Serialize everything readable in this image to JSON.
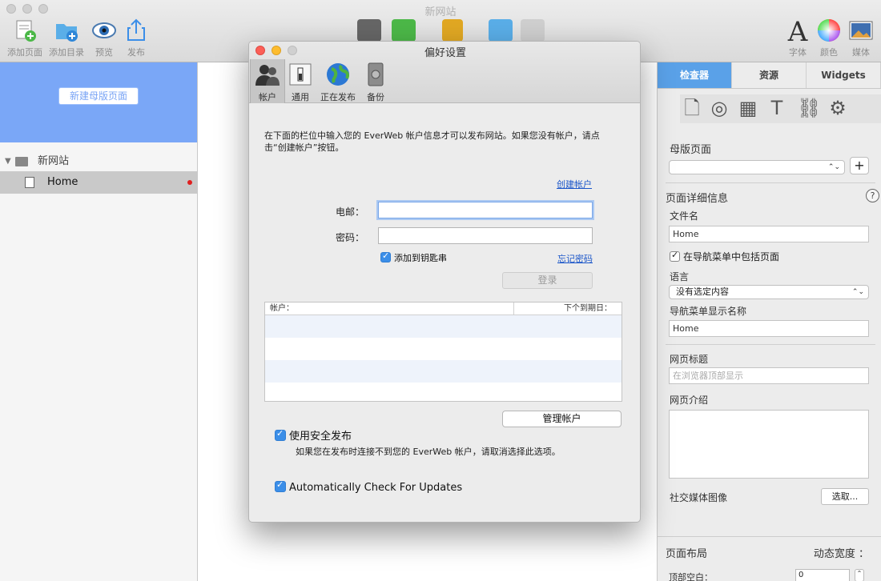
{
  "window": {
    "title": "新网站"
  },
  "toolbar": {
    "add_page": "添加页面",
    "add_folder": "添加目录",
    "preview": "预览",
    "publish": "发布",
    "font": "字体",
    "color": "颜色",
    "media": "媒体"
  },
  "sidebar": {
    "new_master_button": "新建母版页面",
    "site_name": "新网站",
    "pages": [
      {
        "label": "Home"
      }
    ]
  },
  "inspector": {
    "tabs": [
      {
        "label": "检查器",
        "active": true
      },
      {
        "label": "资源"
      },
      {
        "label": "Widgets"
      }
    ],
    "master_page_label": "母版页面",
    "page_details_label": "页面详细信息",
    "filename_label": "文件名",
    "filename_value": "Home",
    "include_in_nav_label": "在导航菜单中包括页面",
    "include_in_nav_checked": true,
    "language_label": "语言",
    "language_value": "没有选定内容",
    "nav_name_label": "导航菜单显示名称",
    "nav_name_value": "Home",
    "page_title_label": "网页标题",
    "page_title_placeholder": "在浏览器顶部显示",
    "page_intro_label": "网页介绍",
    "social_image_label": "社交媒体图像",
    "select_button": "选取...",
    "layout_label": "页面布局",
    "dynamic_width_label": "动态宽度 ：",
    "top_space_label": "顶部空白：",
    "top_space_value": "0"
  },
  "dialog": {
    "title": "偏好设置",
    "tabs": [
      {
        "label": "帐户",
        "active": true
      },
      {
        "label": "通用"
      },
      {
        "label": "正在发布"
      },
      {
        "label": "备份"
      }
    ],
    "intro": "在下面的栏位中输入您的 EverWeb 帐户信息才可以发布网站。如果您没有帐户，请点击“创建帐户”按钮。",
    "create_account_link": "创建帐户",
    "email_label": "电邮：",
    "email_value": "",
    "password_label": "密码：",
    "password_value": "",
    "keychain_label": "添加到钥匙串",
    "keychain_checked": true,
    "forgot_password_link": "忘记密码",
    "login_button": "登录",
    "table": {
      "col_account": "帐户：",
      "col_expiry": "下个到期日："
    },
    "manage_button": "管理帐户",
    "secure_publish_label": "使用安全发布",
    "secure_publish_checked": true,
    "secure_publish_note": "如果您在发布时连接不到您的 EverWeb 帐户，请取消选择此选项。",
    "auto_update_label": "Automatically Check For Updates",
    "auto_update_checked": true
  },
  "colors": {
    "accent": "#3b8ee8",
    "master_area": "#7aa7f7",
    "link": "#1b56c9",
    "unsaved_dot": "#e02020"
  }
}
